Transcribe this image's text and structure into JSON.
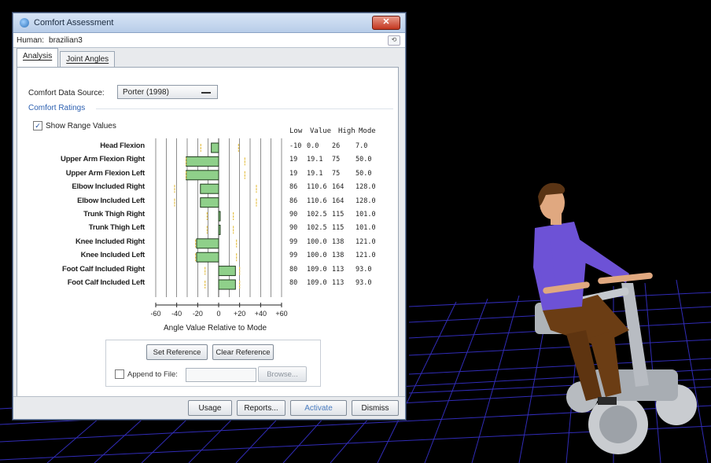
{
  "window": {
    "title": "Comfort Assessment",
    "close_glyph": "✕"
  },
  "human": {
    "label": "Human:",
    "value": "brazilian3",
    "pin_icon": "pin-icon"
  },
  "tabs": [
    {
      "label": "Analysis",
      "active": true
    },
    {
      "label": "Joint Angles",
      "active": false
    }
  ],
  "source": {
    "label": "Comfort Data Source:",
    "value": "Porter (1998)"
  },
  "ratings": {
    "title": "Comfort Ratings",
    "show_range_label": "Show Range Values",
    "show_range_checked": true,
    "columns": [
      "Low",
      "Value",
      "High",
      "Mode"
    ],
    "axis_ticks": [
      "-60",
      "-40",
      "-20",
      "0",
      "+20",
      "+40",
      "+60"
    ],
    "axis_title": "Angle Value Relative to Mode",
    "rows": [
      {
        "label": "Head Flexion",
        "low": "-10",
        "value": "0.0",
        "high": "26",
        "mode": "7.0"
      },
      {
        "label": "Upper Arm Flexion Right",
        "low": "19",
        "value": "19.1",
        "high": "75",
        "mode": "50.0"
      },
      {
        "label": "Upper Arm Flexion Left",
        "low": "19",
        "value": "19.1",
        "high": "75",
        "mode": "50.0"
      },
      {
        "label": "Elbow Included Right",
        "low": "86",
        "value": "110.6",
        "high": "164",
        "mode": "128.0"
      },
      {
        "label": "Elbow Included Left",
        "low": "86",
        "value": "110.6",
        "high": "164",
        "mode": "128.0"
      },
      {
        "label": "Trunk Thigh Right",
        "low": "90",
        "value": "102.5",
        "high": "115",
        "mode": "101.0"
      },
      {
        "label": "Trunk Thigh Left",
        "low": "90",
        "value": "102.5",
        "high": "115",
        "mode": "101.0"
      },
      {
        "label": "Knee Included Right",
        "low": "99",
        "value": "100.0",
        "high": "138",
        "mode": "121.0"
      },
      {
        "label": "Knee Included Left",
        "low": "99",
        "value": "100.0",
        "high": "138",
        "mode": "121.0"
      },
      {
        "label": "Foot Calf Included Right",
        "low": "80",
        "value": "109.0",
        "high": "113",
        "mode": "93.0"
      },
      {
        "label": "Foot Calf Included Left",
        "low": "80",
        "value": "109.0",
        "high": "113",
        "mode": "93.0"
      }
    ]
  },
  "actions": {
    "set_reference": "Set Reference",
    "clear_reference": "Clear Reference",
    "append_label": "Append to File:",
    "browse": "Browse..."
  },
  "footer": {
    "usage": "Usage",
    "reports": "Reports...",
    "activate": "Activate",
    "dismiss": "Dismiss"
  },
  "colors": {
    "bar": "#8fd08a",
    "range_marker": "#e6c24a",
    "grid": "#222222",
    "floor_grid": "#3a34d8",
    "shirt": "#6d52d6",
    "pants": "#6b3d14"
  }
}
